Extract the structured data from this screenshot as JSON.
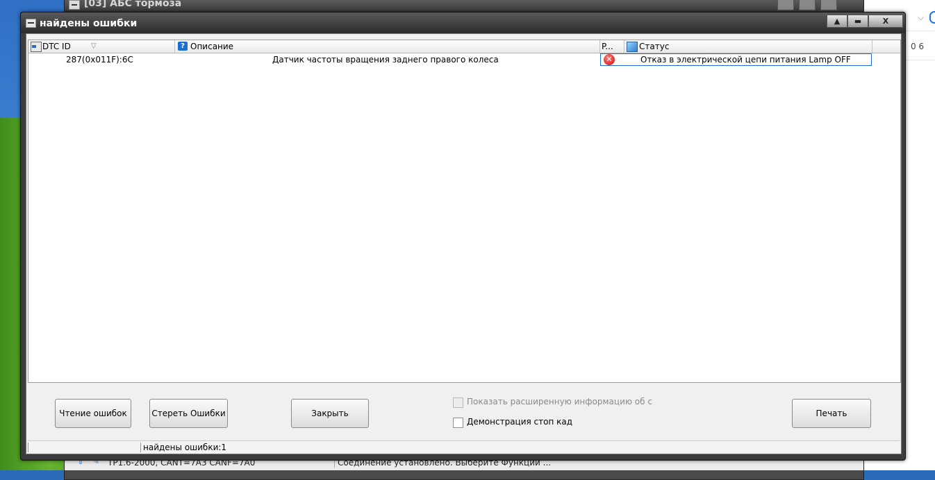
{
  "background_window": {
    "title": "[03] АБС тормоза",
    "status": {
      "connection": "TP1.6-2000, CANT=7A3 CANF=7A0",
      "message": "Соединение установлено. Выберите Функции ..."
    }
  },
  "right_app": {
    "text": "0 6"
  },
  "dialog": {
    "title": "найдены ошибки",
    "titlebar_buttons": {
      "up": "▲",
      "minimize": "▬",
      "close": "X"
    },
    "grid": {
      "columns": {
        "dtc_id": "DTC ID",
        "description": "Описание",
        "p": "P...",
        "status": "Статус"
      },
      "rows": [
        {
          "dtc_id": "287(0x011F):6C",
          "description": "Датчик частоты вращения заднего правого колеса",
          "status": "Отказ в электрической цепи питания Lamp OFF"
        }
      ]
    },
    "buttons": {
      "read": "Чтение ошибок",
      "erase": "Стереть Ошибки",
      "close": "Закрыть",
      "print": "Печать"
    },
    "checkboxes": {
      "extended_info": "Показать расширенную информацию об с",
      "freeze_frame": "Демонстрация стоп кад"
    },
    "status": "найдены ошибки:1"
  },
  "colors": {
    "selection_border": "#1e6ed8",
    "error_icon": "#d10b0b",
    "titlebar": "#2b2b2b"
  }
}
